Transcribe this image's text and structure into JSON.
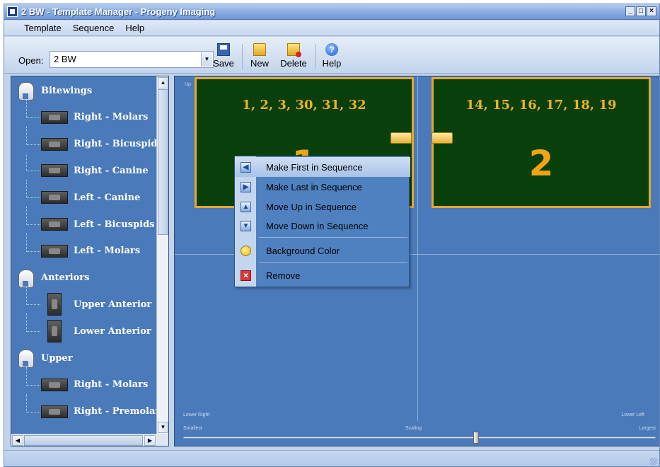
{
  "window": {
    "title": "2 BW - Template Manager - Progeny Imaging",
    "controls": [
      "_",
      "□",
      "×"
    ]
  },
  "menu": [
    "Template",
    "Sequence",
    "Help"
  ],
  "toolbar": {
    "open_label": "Open:",
    "open_value": "2 BW",
    "buttons": {
      "save": "Save",
      "new": "New",
      "delete": "Delete",
      "help": "Help"
    }
  },
  "tree": {
    "items": [
      {
        "label": "Bitewings",
        "kind": "group",
        "icon": "tooth-group-icon"
      },
      {
        "label": "Right - Molars",
        "kind": "film",
        "icon": "film-horizontal-icon"
      },
      {
        "label": "Right - Bicuspids",
        "kind": "film",
        "icon": "film-horizontal-icon"
      },
      {
        "label": "Right - Canine",
        "kind": "film",
        "icon": "film-horizontal-icon"
      },
      {
        "label": "Left - Canine",
        "kind": "film",
        "icon": "film-horizontal-icon"
      },
      {
        "label": "Left - Bicuspids",
        "kind": "film",
        "icon": "film-horizontal-icon"
      },
      {
        "label": "Left - Molars",
        "kind": "film",
        "icon": "film-horizontal-icon"
      },
      {
        "label": "Anteriors",
        "kind": "group",
        "icon": "tooth-group-icon"
      },
      {
        "label": "Upper Anterior",
        "kind": "film-v",
        "icon": "film-vertical-icon"
      },
      {
        "label": "Lower Anterior",
        "kind": "film-v",
        "icon": "film-vertical-icon"
      },
      {
        "label": "Upper",
        "kind": "group",
        "icon": "tooth-group-icon"
      },
      {
        "label": "Right - Molars",
        "kind": "film",
        "icon": "film-horizontal-icon"
      },
      {
        "label": "Right - Premolars",
        "kind": "film",
        "icon": "film-horizontal-icon"
      }
    ]
  },
  "canvas": {
    "corner_labels": {
      "top_left": "Up",
      "lower_right": "Lower Right",
      "lower_left": "Lower Left"
    },
    "slider": {
      "min_label": "Smallest",
      "mid_label": "Scaling",
      "max_label": "Largest",
      "value": 0.62
    },
    "films": [
      {
        "teeth": "1, 2, 3, 30, 31, 32",
        "sequence": "1"
      },
      {
        "teeth": "14, 15, 16, 17, 18, 19",
        "sequence": "2"
      }
    ],
    "film_colors": {
      "background": "#083f0b",
      "border": "#e8a62a",
      "text": "#f0b020"
    }
  },
  "context_menu": {
    "items": [
      {
        "label": "Make First in Sequence",
        "icon": "move-first-icon"
      },
      {
        "label": "Make Last in Sequence",
        "icon": "move-last-icon"
      },
      {
        "label": "Move Up in Sequence",
        "icon": "move-up-icon"
      },
      {
        "label": "Move Down in Sequence",
        "icon": "move-down-icon"
      },
      {
        "label": "Background Color",
        "icon": "palette-icon"
      },
      {
        "label": "Remove",
        "icon": "remove-icon"
      }
    ]
  }
}
